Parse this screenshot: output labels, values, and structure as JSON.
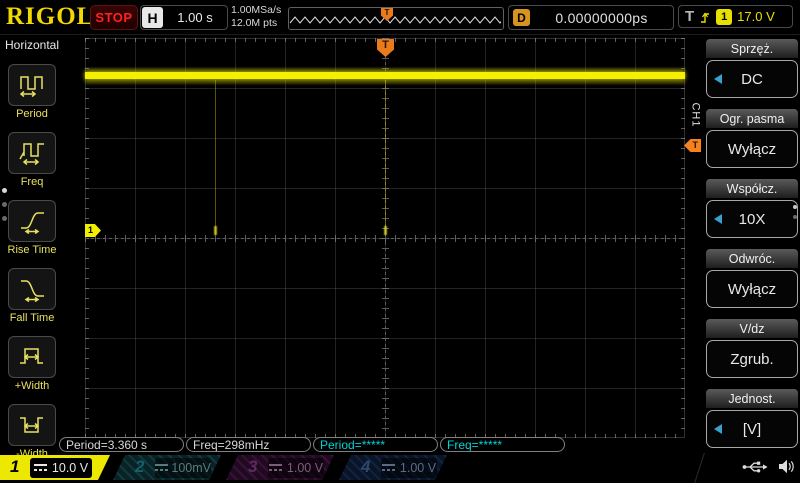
{
  "colors": {
    "ch1_yellow": "#f2ee00",
    "ch2_cyan": "#00c8d8",
    "ch3_magenta": "#cc33cc",
    "ch4_blue": "#3377dd",
    "trigger_orange": "#f5821f",
    "measure_cyan": "#00d4d4",
    "stop_red": "#ff2222",
    "menu_arrow_blue": "#3aa0d0"
  },
  "top_bar": {
    "logo": "RIGOL",
    "run_state": "STOP",
    "horizontal_label": "H",
    "timebase": "1.00 s",
    "sample_rate": "1.00MSa/s",
    "memory_depth": "12.0M pts",
    "preview_trigger_label": "T",
    "delay_label": "D",
    "delay_value": "0.00000000ps",
    "trigger_label": "T",
    "trigger_source": "1",
    "trigger_level": "17.0 V"
  },
  "left_menu": {
    "title": "Horizontal",
    "items": [
      {
        "label": "Period",
        "icon": "period-icon"
      },
      {
        "label": "Freq",
        "icon": "freq-icon"
      },
      {
        "label": "Rise Time",
        "icon": "rise-time-icon"
      },
      {
        "label": "Fall Time",
        "icon": "fall-time-icon"
      },
      {
        "label": "+Width",
        "icon": "plus-width-icon"
      },
      {
        "label": "-Width",
        "icon": "minus-width-icon"
      }
    ]
  },
  "graticule": {
    "channel_marker_label": "1",
    "trigger_position_label": "T",
    "trigger_level_label": "T"
  },
  "right_menu": {
    "channel_tab": "CH1",
    "items": [
      {
        "header": "Sprzęż.",
        "value": "DC",
        "has_arrow": true
      },
      {
        "header": "Ogr. pasma",
        "value": "Wyłącz",
        "has_arrow": false
      },
      {
        "header": "Współcz.",
        "value": "10X",
        "has_arrow": true
      },
      {
        "header": "Odwróc.",
        "value": "Wyłącz",
        "has_arrow": false
      },
      {
        "header": "V/dz",
        "value": "Zgrub.",
        "has_arrow": false
      },
      {
        "header": "Jednost.",
        "value": "[V]",
        "has_arrow": true
      }
    ]
  },
  "measurements": [
    {
      "text": "Period=3.360 s",
      "style": "white"
    },
    {
      "text": "Freq=298mHz",
      "style": "white"
    },
    {
      "text": "Period=*****",
      "style": "cyan"
    },
    {
      "text": "Freq=*****",
      "style": "cyan"
    }
  ],
  "channel_bar": [
    {
      "number": "1",
      "scale": "10.0 V",
      "active": true
    },
    {
      "number": "2",
      "scale": "100mV",
      "active": false
    },
    {
      "number": "3",
      "scale": "1.00 V",
      "active": false
    },
    {
      "number": "4",
      "scale": "1.00 V",
      "active": false
    }
  ]
}
